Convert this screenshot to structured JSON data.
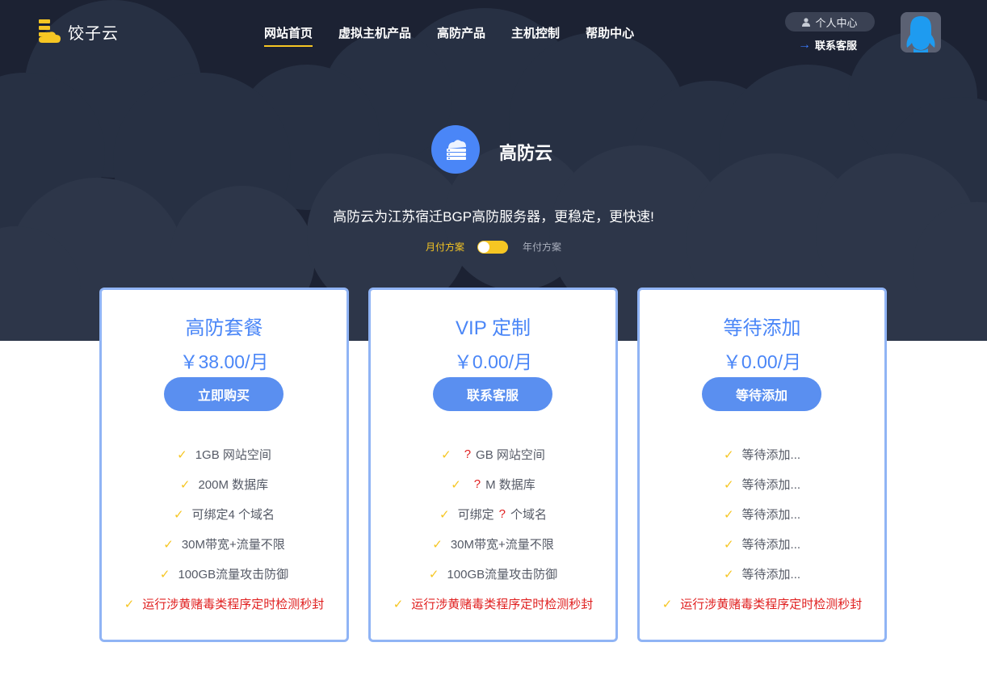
{
  "brand": {
    "name": "饺子云"
  },
  "nav": {
    "items": [
      {
        "label": "网站首页",
        "active": true
      },
      {
        "label": "虚拟主机产品",
        "active": false
      },
      {
        "label": "高防产品",
        "active": false
      },
      {
        "label": "主机控制",
        "active": false
      },
      {
        "label": "帮助中心",
        "active": false
      }
    ]
  },
  "user": {
    "personal_center": "个人中心",
    "contact_service": "联系客服"
  },
  "hero": {
    "title": "高防云",
    "description": "高防云为江苏宿迁BGP高防服务器，更稳定，更快速!",
    "billing_month": "月付方案",
    "billing_year": "年付方案"
  },
  "colors": {
    "accent": "#4a86f7",
    "highlight": "#f6c623",
    "warning": "#e02020",
    "hero_bg": "#1c2233"
  },
  "plans": [
    {
      "title": "高防套餐",
      "price": "￥38.00/月",
      "button": "立即购买",
      "features": [
        {
          "parts": [
            "1GB 网站空间"
          ]
        },
        {
          "parts": [
            "200M 数据库"
          ]
        },
        {
          "parts": [
            "可绑定4 个域名"
          ]
        },
        {
          "parts": [
            "30M带宽+流量不限"
          ]
        },
        {
          "parts": [
            "100GB流量攻击防御"
          ]
        },
        {
          "parts": [
            "运行涉黄赌毒类程序定时检测秒封"
          ],
          "warn": true
        }
      ]
    },
    {
      "title": "VIP 定制",
      "price": "￥0.00/月",
      "button": "联系客服",
      "features": [
        {
          "parts": [
            "",
            "?",
            "GB 网站空间"
          ]
        },
        {
          "parts": [
            "",
            "?",
            "M 数据库"
          ]
        },
        {
          "parts": [
            "可绑定",
            "?",
            "个域名"
          ]
        },
        {
          "parts": [
            "30M带宽+流量不限"
          ]
        },
        {
          "parts": [
            "100GB流量攻击防御"
          ]
        },
        {
          "parts": [
            "运行涉黄赌毒类程序定时检测秒封"
          ],
          "warn": true
        }
      ]
    },
    {
      "title": "等待添加",
      "price": "￥0.00/月",
      "button": "等待添加",
      "features": [
        {
          "parts": [
            "等待添加..."
          ]
        },
        {
          "parts": [
            "等待添加..."
          ]
        },
        {
          "parts": [
            "等待添加..."
          ]
        },
        {
          "parts": [
            "等待添加..."
          ]
        },
        {
          "parts": [
            "等待添加..."
          ]
        },
        {
          "parts": [
            "运行涉黄赌毒类程序定时检测秒封"
          ],
          "warn": true
        }
      ]
    }
  ]
}
